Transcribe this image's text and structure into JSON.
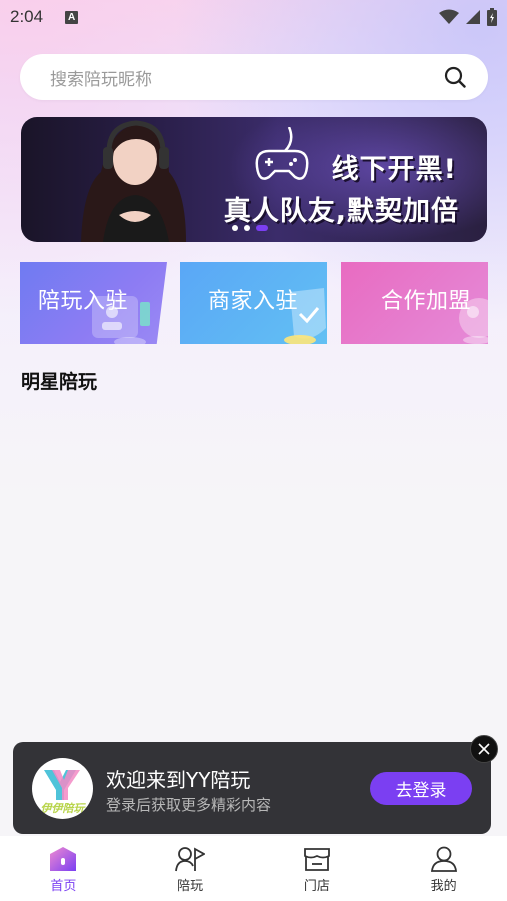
{
  "status_bar": {
    "time": "2:04",
    "notif_icon": "A"
  },
  "search": {
    "placeholder": "搜索陪玩昵称",
    "icon": "search-icon"
  },
  "banner": {
    "line1": "线下开黑!",
    "line2": "真人队友,默契加倍",
    "dots": 3,
    "active_dot": 3
  },
  "entry_cards": [
    {
      "label": "陪玩入驻"
    },
    {
      "label": "商家入驻"
    },
    {
      "label": "合作加盟"
    }
  ],
  "section": {
    "title": "明星陪玩"
  },
  "login_popup": {
    "logo_text": "伊伊陪玩",
    "title": "欢迎来到YY陪玩",
    "subtitle": "登录后获取更多精彩内容",
    "button": "去登录"
  },
  "tabbar": {
    "items": [
      {
        "label": "首页",
        "icon": "home-icon",
        "active": true
      },
      {
        "label": "陪玩",
        "icon": "companion-icon",
        "active": false
      },
      {
        "label": "门店",
        "icon": "store-icon",
        "active": false
      },
      {
        "label": "我的",
        "icon": "profile-icon",
        "active": false
      }
    ]
  },
  "colors": {
    "accent": "#7b3ff2"
  }
}
